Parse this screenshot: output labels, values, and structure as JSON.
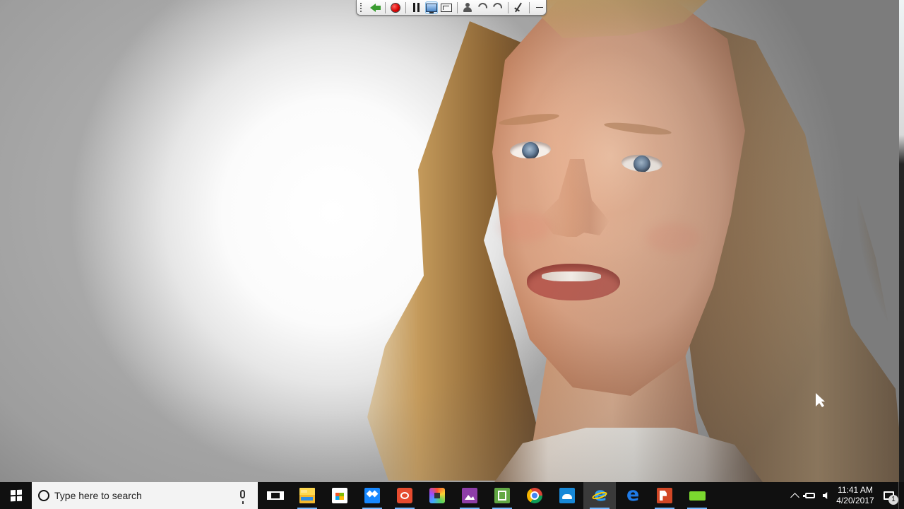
{
  "recorder": {
    "buttons": [
      {
        "name": "back",
        "icon": "green-back-arrow-icon"
      },
      {
        "name": "record",
        "icon": "record-icon"
      },
      {
        "name": "pause",
        "icon": "pause-icon"
      },
      {
        "name": "screen",
        "icon": "monitor-icon"
      },
      {
        "name": "area",
        "icon": "screen-select-icon"
      },
      {
        "name": "webcam",
        "icon": "webcam-icon"
      },
      {
        "name": "phone",
        "icon": "phone-icon"
      },
      {
        "name": "audio",
        "icon": "audio-icon"
      },
      {
        "name": "draw",
        "icon": "pen-icon"
      },
      {
        "name": "minimize",
        "icon": "minimize-icon"
      }
    ]
  },
  "taskbar": {
    "search": {
      "placeholder": "Type here to search"
    },
    "apps": [
      {
        "name": "file-explorer",
        "icon": "folder-icon"
      },
      {
        "name": "microsoft-store",
        "icon": "store-icon"
      },
      {
        "name": "dropbox",
        "icon": "dropbox-icon"
      },
      {
        "name": "camera-app",
        "icon": "camera-app-icon"
      },
      {
        "name": "colorful-app",
        "icon": "colorful-app-icon"
      },
      {
        "name": "pictures-app",
        "icon": "pictures-icon"
      },
      {
        "name": "green-app",
        "icon": "green-book-icon"
      },
      {
        "name": "chrome",
        "icon": "chrome-icon"
      },
      {
        "name": "cloud-app",
        "icon": "cloud-icon"
      },
      {
        "name": "internet-explorer",
        "icon": "internet-explorer-icon"
      },
      {
        "name": "edge",
        "icon": "edge-icon"
      },
      {
        "name": "powerpoint",
        "icon": "powerpoint-icon"
      },
      {
        "name": "chat-app",
        "icon": "chat-icon"
      }
    ],
    "clock": {
      "time": "11:41 AM",
      "date": "4/20/2017"
    },
    "notifications": {
      "count": "1"
    }
  }
}
